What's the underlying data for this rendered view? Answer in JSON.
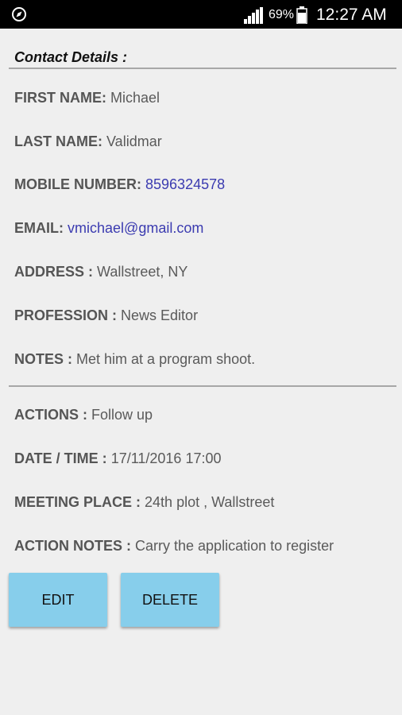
{
  "status_bar": {
    "battery_percent": "69%",
    "time": "12:27 AM",
    "icons": [
      "compass-icon",
      "signal-icon",
      "battery-icon"
    ]
  },
  "contact": {
    "section_title": "Contact Details :",
    "first_name": {
      "label": "FIRST NAME:",
      "value": "Michael"
    },
    "last_name": {
      "label": "LAST NAME:",
      "value": "Validmar"
    },
    "mobile": {
      "label": "MOBILE NUMBER:",
      "value": "8596324578"
    },
    "email": {
      "label": "EMAIL:",
      "value": "vmichael@gmail.com"
    },
    "address": {
      "label": "ADDRESS :",
      "value": "Wallstreet, NY"
    },
    "profession": {
      "label": "PROFESSION :",
      "value": "News Editor"
    },
    "notes": {
      "label": "NOTES :",
      "value": "Met him at a program shoot."
    }
  },
  "actions": {
    "actions": {
      "label": "ACTIONS :",
      "value": "Follow up"
    },
    "date_time": {
      "label": "DATE / TIME :",
      "value": "17/11/2016 17:00"
    },
    "meeting_place": {
      "label": "MEETING PLACE :",
      "value": "24th plot , Wallstreet"
    },
    "action_notes": {
      "label": "ACTION NOTES :",
      "value": "Carry the application to register"
    }
  },
  "buttons": {
    "edit_label": "EDIT",
    "delete_label": "DELETE"
  },
  "colors": {
    "button_bg": "#87ceeb",
    "link_text": "#3b3bb0",
    "background": "#efefef"
  }
}
